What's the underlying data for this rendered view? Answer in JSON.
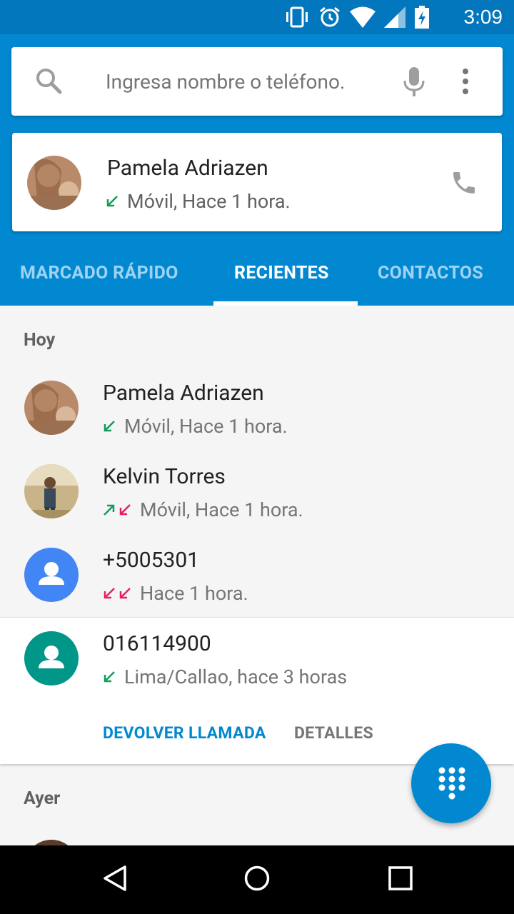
{
  "status_bar": {
    "time": "3:09"
  },
  "search": {
    "placeholder": "Ingresa nombre o teléfono."
  },
  "top_card": {
    "name": "Pamela Adriazen",
    "detail": "Móvil, Hace 1 hora."
  },
  "tabs": [
    {
      "label": "MARCADO RÁPIDO",
      "active": false
    },
    {
      "label": "RECIENTES",
      "active": true
    },
    {
      "label": "CONTACTOS",
      "active": false
    }
  ],
  "sections": {
    "today": "Hoy",
    "yesterday": "Ayer"
  },
  "calls": [
    {
      "name": "Pamela Adriazen",
      "detail": "Móvil, Hace 1 hora.",
      "call_types": [
        "incoming"
      ]
    },
    {
      "name": "Kelvin Torres",
      "detail": "Móvil, Hace 1 hora.",
      "call_types": [
        "outgoing",
        "missed"
      ]
    },
    {
      "name": "+5005301",
      "detail": "Hace 1 hora.",
      "call_types": [
        "missed",
        "missed"
      ],
      "avatar_color": "#4285f4"
    },
    {
      "name": "016114900",
      "detail": "Lima/Callao, hace 3 horas",
      "call_types": [
        "incoming"
      ],
      "avatar_color": "#009688"
    }
  ],
  "actions": {
    "call_back": "DEVOLVER LLAMADA",
    "details": "DETALLES"
  },
  "colors": {
    "primary": "#0288d1",
    "status_bar": "#0277bd",
    "incoming": "#0f9d58",
    "missed": "#e91e63"
  }
}
